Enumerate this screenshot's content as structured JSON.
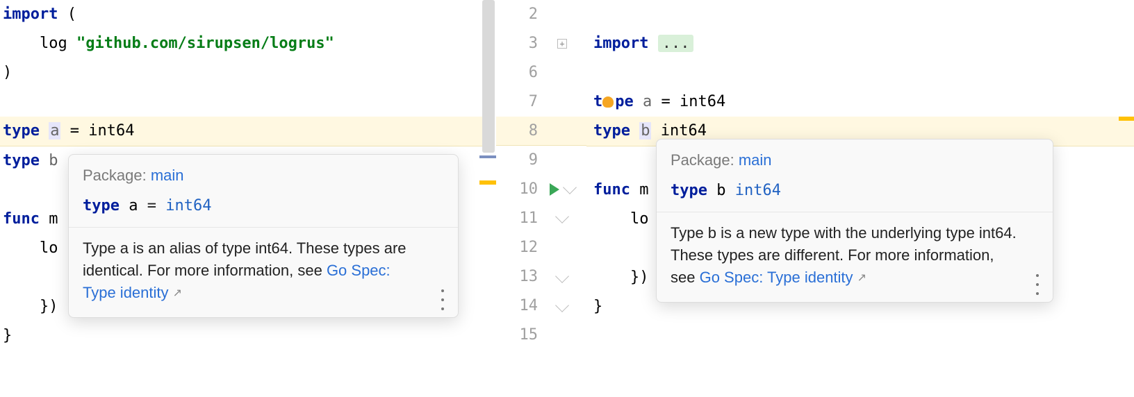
{
  "left_code": {
    "l1_import": "import",
    "l1_open": " (",
    "l2_prefix": "    log ",
    "l2_str": "\"github.com/sirupsen/logrus\"",
    "l3": ")",
    "l5_kw": "type",
    "l5_sp": " ",
    "l5_id": "a",
    "l5_rest": " = int64",
    "l6_kw": "type",
    "l6_sp": " ",
    "l6_id": "b",
    "l8_kw": "func",
    "l8_rest": " m",
    "l9": "    lo",
    "l11": "    })",
    "l12": "}"
  },
  "right_code": {
    "r3_kw": "import ",
    "r3_fold": "...",
    "r7_t": "t",
    "r7_rest": "pe ",
    "r7_id": "a",
    "r7_eq": " = int64",
    "r8_kw": "type ",
    "r8_id": "b",
    "r8_rest": " int64",
    "r10_kw": "func",
    "r10_rest": " m",
    "r11": "    lo",
    "r13": "    })",
    "r14": "}"
  },
  "gutter": {
    "n2": "2",
    "n3": "3",
    "n6": "6",
    "n7": "7",
    "n8": "8",
    "n9": "9",
    "n10": "10",
    "n11": "11",
    "n12": "12",
    "n13": "13",
    "n14": "14",
    "n15": "15"
  },
  "popup_left": {
    "pkg_label": "Package: ",
    "pkg_name": "main",
    "def_kw": "type",
    "def_sp": " ",
    "def_id": "a",
    "def_rest": " = ",
    "def_typ": "int64",
    "desc_pre": "Type a is an alias of type int64. These types are identical. For more information, see ",
    "link": "Go Spec: Type identity"
  },
  "popup_right": {
    "pkg_label": "Package: ",
    "pkg_name": "main",
    "def_kw": "type",
    "def_sp": " ",
    "def_id": "b",
    "def_sp2": " ",
    "def_typ": "int64",
    "desc_pre": "Type b is a new type with the underlying type int64. These types are different. For more information, see ",
    "link": "Go Spec: Type identity"
  }
}
